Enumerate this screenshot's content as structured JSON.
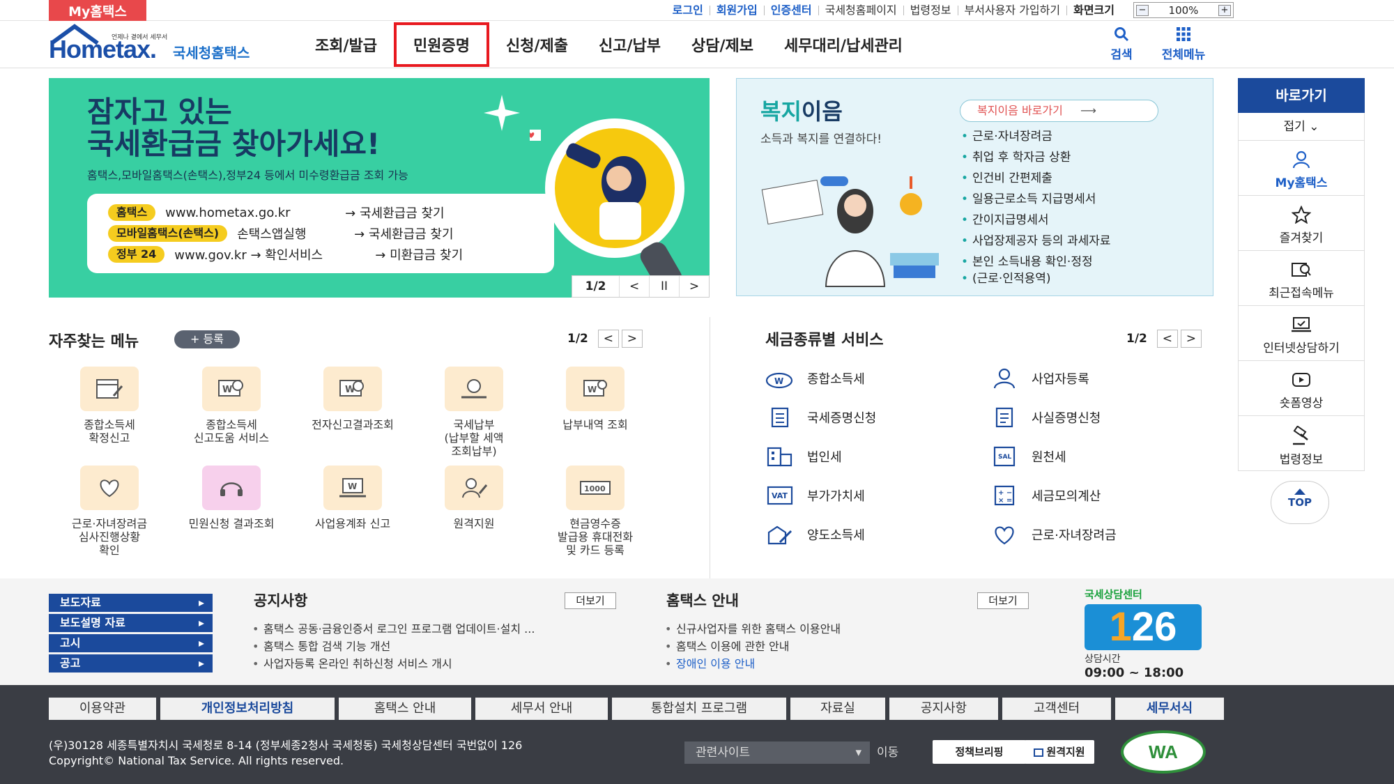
{
  "topbar": {
    "myhome": "My홈택스",
    "util_links": [
      {
        "label": "로그인",
        "style": "blue"
      },
      {
        "label": "회원가입",
        "style": "blue"
      },
      {
        "label": "인증센터",
        "style": "blue"
      },
      {
        "label": "국세청홈페이지",
        "style": ""
      },
      {
        "label": "법령정보",
        "style": ""
      },
      {
        "label": "부서사용자 가입하기",
        "style": ""
      },
      {
        "label": "화면크기",
        "style": "bold"
      }
    ],
    "zoom": {
      "minus": "−",
      "value": "100%",
      "plus": "+"
    }
  },
  "header": {
    "logo_small": "언제나 곁에서 세무서",
    "logo_main": "Hometax.",
    "logo_kr": "국세청홈택스",
    "nav": [
      "조회/발급",
      "민원증명",
      "신청/제출",
      "신고/납부",
      "상담/제보",
      "세무대리/납세관리"
    ],
    "nav_selected": "민원증명",
    "search": "검색",
    "allmenu": "전체메뉴"
  },
  "banner": {
    "title_line1": "잠자고 있는",
    "title_line2": "국세환급금 찾아가세요!",
    "subtitle": "홈택스,모바일홈택스(손택스),정부24 등에서 미수령환급금 조회 가능",
    "rows": [
      {
        "tag": "홈택스",
        "url": "www.hometax.go.kr",
        "action": "→ 국세환급금 찾기"
      },
      {
        "tag": "모바일홈택스(손택스)",
        "url": "손택스앱실행",
        "action": "→ 국세환급금 찾기"
      },
      {
        "tag": "정부 24",
        "url": "www.gov.kr → 확인서비스",
        "action": "→ 미환급금 찾기"
      }
    ],
    "pager": "1/2",
    "prev": "<",
    "pause": "II",
    "next": ">"
  },
  "welfare": {
    "title_a": "복지",
    "title_b": "이음",
    "desc": "소득과 복지를 연결하다!",
    "go_button": "복지이음 바로가기",
    "items": [
      "근로·자녀장려금",
      "취업 후 학자금 상환",
      "인건비 간편제출",
      "일용근로소득 지급명세서",
      "간이지급명세서",
      "사업장제공자 등의 과세자료",
      "본인 소득내용 확인·정정",
      "(근로·인적용역)"
    ]
  },
  "quick": {
    "header": "바로가기",
    "fold": "접기 ⌄",
    "items": [
      {
        "label": "My홈택스",
        "icon": "user-icon"
      },
      {
        "label": "즐겨찾기",
        "icon": "star-icon"
      },
      {
        "label": "최근접속메뉴",
        "icon": "recent-menu-icon"
      },
      {
        "label": "인터넷상담하기",
        "icon": "consult-icon"
      },
      {
        "label": "숏폼영상",
        "icon": "video-icon"
      },
      {
        "label": "법령정보",
        "icon": "gavel-icon"
      }
    ],
    "top": "TOP"
  },
  "freq": {
    "title": "자주찾는 메뉴",
    "register": "+ 등록",
    "pager": "1/2",
    "items": [
      {
        "line1": "종합소득세",
        "line2": "확정신고",
        "line3": ""
      },
      {
        "line1": "종합소득세",
        "line2": "신고도움 서비스",
        "line3": ""
      },
      {
        "line1": "전자신고결과조회",
        "line2": "",
        "line3": ""
      },
      {
        "line1": "국세납부",
        "line2": "(납부할 세액",
        "line3": "조회납부)"
      },
      {
        "line1": "납부내역 조회",
        "line2": "",
        "line3": ""
      },
      {
        "line1": "근로·자녀장려금",
        "line2": "심사진행상황",
        "line3": "확인"
      },
      {
        "line1": "민원신청 결과조회",
        "line2": "",
        "line3": ""
      },
      {
        "line1": "사업용계좌 신고",
        "line2": "",
        "line3": ""
      },
      {
        "line1": "원격지원",
        "line2": "",
        "line3": ""
      },
      {
        "line1": "현금영수증",
        "line2": "발급용 휴대전화",
        "line3": "및 카드 등록"
      }
    ]
  },
  "tax": {
    "title": "세금종류별 서비스",
    "pager": "1/2",
    "left": [
      "종합소득세",
      "국세증명신청",
      "법인세",
      "부가가치세",
      "양도소득세"
    ],
    "right": [
      "사업자등록",
      "사실증명신청",
      "원천세",
      "세금모의계산",
      "근로·자녀장려금"
    ]
  },
  "band": {
    "links": [
      "보도자료",
      "보도설명 자료",
      "고시",
      "공고"
    ],
    "notice_title": "공지사항",
    "notice_more": "더보기",
    "notices": [
      "홈택스 공동·금융인증서 로그인 프로그램 업데이트·설치 ...",
      "홈택스 통합 검색 기능 개선",
      "사업자등록 온라인 취하신청 서비스 개시"
    ],
    "guide_title": "홈택스 안내",
    "guide_more": "더보기",
    "guides": [
      "신규사업자를 위한 홈택스 이용안내",
      "홈택스 이용에 관한 안내",
      "장애인 이용 안내"
    ],
    "center_label": "국세상담센터",
    "center_num_a": "1",
    "center_num_b": "26",
    "center_hours_label": "상담시간",
    "center_hours": "09:00 ~ 18:00"
  },
  "footer": {
    "nav": [
      "이용약관",
      "개인정보처리방침",
      "홈택스 안내",
      "세무서 안내",
      "통합설치 프로그램",
      "자료실",
      "공지사항",
      "고객센터",
      "세무서식"
    ],
    "address": "(우)30128 세종특별자치시 국세청로 8-14 (정부세종2청사 국세청동) 국세청상담센터 국번없이 126",
    "copyright": "Copyright© National Tax Service. All rights reserved.",
    "related_select": "관련사이트",
    "go": "이동",
    "policy_briefing": "정책브리핑",
    "remote": "원격지원",
    "wa_mark": "WA"
  }
}
